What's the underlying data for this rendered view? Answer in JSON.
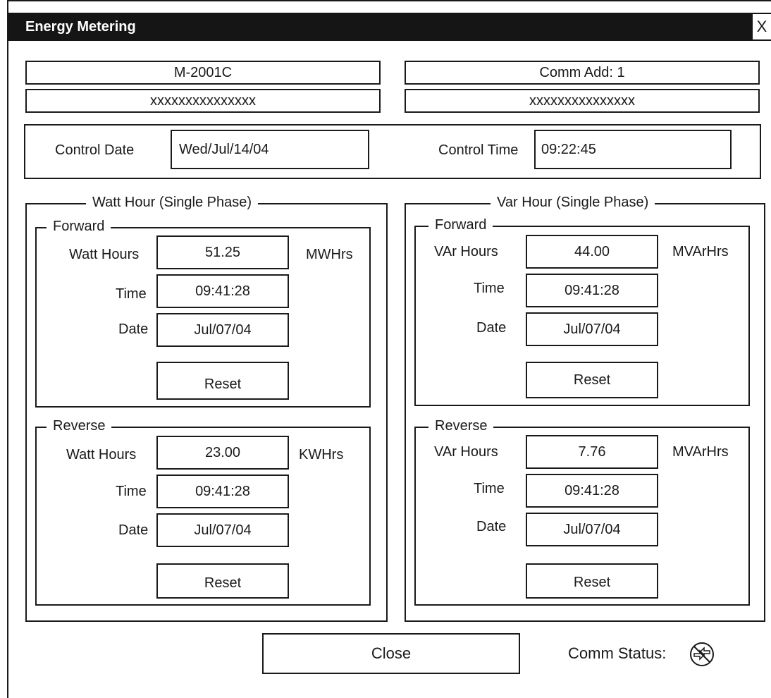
{
  "window": {
    "title": "Energy Metering",
    "close_glyph": "X"
  },
  "header": {
    "device_model": "M-2001C",
    "device_serial": "xxxxxxxxxxxxxxx",
    "comm_address": "Comm Add: 1",
    "comm_info": "xxxxxxxxxxxxxxx"
  },
  "control": {
    "date_label": "Control Date",
    "date_value": "Wed/Jul/14/04",
    "time_label": "Control Time",
    "time_value": "09:22:45"
  },
  "watt": {
    "title": "Watt Hour (Single Phase)",
    "forward": {
      "title": "Forward",
      "hours_label": "Watt Hours",
      "hours_value": "51.25",
      "unit": "MWHrs",
      "time_label": "Time",
      "time_value": "09:41:28",
      "date_label": "Date",
      "date_value": "Jul/07/04",
      "reset_label": "Reset"
    },
    "reverse": {
      "title": "Reverse",
      "hours_label": "Watt Hours",
      "hours_value": "23.00",
      "unit": "KWHrs",
      "time_label": "Time",
      "time_value": "09:41:28",
      "date_label": "Date",
      "date_value": "Jul/07/04",
      "reset_label": "Reset"
    }
  },
  "var": {
    "title": "Var Hour (Single Phase)",
    "forward": {
      "title": "Forward",
      "hours_label": "VAr Hours",
      "hours_value": "44.00",
      "unit": "MVArHrs",
      "time_label": "Time",
      "time_value": "09:41:28",
      "date_label": "Date",
      "date_value": "Jul/07/04",
      "reset_label": "Reset"
    },
    "reverse": {
      "title": "Reverse",
      "hours_label": "VAr Hours",
      "hours_value": "7.76",
      "unit": "MVArHrs",
      "time_label": "Time",
      "time_value": "09:41:28",
      "date_label": "Date",
      "date_value": "Jul/07/04",
      "reset_label": "Reset"
    }
  },
  "footer": {
    "close_label": "Close",
    "comm_status_label": "Comm Status:",
    "comm_status_icon": "comm-disconnected-icon"
  }
}
